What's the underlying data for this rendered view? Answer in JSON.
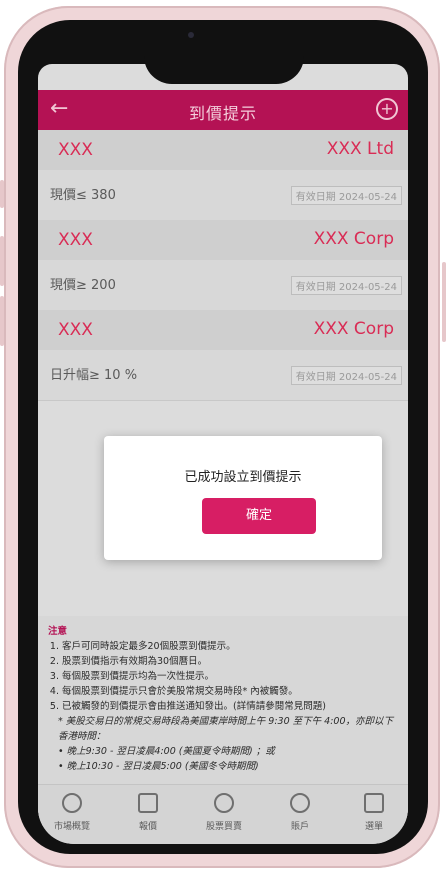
{
  "header": {
    "title": "到價提示",
    "back_icon": "back-arrow-icon",
    "add_icon": "add-circle-icon"
  },
  "alerts": [
    {
      "code": "XXX",
      "name": "XXX Ltd",
      "condition": "現價≤ 380",
      "expiry": "有效日期 2024-05-24"
    },
    {
      "code": "XXX",
      "name": "XXX Corp",
      "condition": "現價≥ 200",
      "expiry": "有效日期 2024-05-24"
    },
    {
      "code": "XXX",
      "name": "XXX Corp",
      "condition": "日升幅≥ 10 %",
      "expiry": "有效日期 2024-05-24"
    }
  ],
  "dialog": {
    "message": "已成功設立到價提示",
    "ok_label": "確定"
  },
  "notes": {
    "title": "注意",
    "items": [
      "客戶可同時設定最多20個股票到價提示。",
      "股票到價指示有效期為30個曆日。",
      "每個股票到價提示均為一次性提示。",
      "每個股票到價提示只會於美股常規交易時段* 內被觸發。",
      "已被觸發的到價提示會由推送通知發出。(詳情請參閱常見問題)"
    ],
    "footnote": "* 美股交易日的常規交易時段為美國東岸時間上午 9:30 至下午 4:00，亦即以下香港時間：",
    "bullets": [
      "晚上9:30 - 翌日凌晨4:00 (美國夏令時期間) ；或",
      "晚上10:30 - 翌日凌晨5:00 (美國冬令時期間)"
    ]
  },
  "tabs": [
    {
      "label": "市場概覽",
      "icon": "globe-icon"
    },
    {
      "label": "報價",
      "icon": "chart-icon"
    },
    {
      "label": "股票買賣",
      "icon": "dollar-icon"
    },
    {
      "label": "賬戶",
      "icon": "account-icon"
    },
    {
      "label": "選單",
      "icon": "menu-grid-icon"
    }
  ]
}
